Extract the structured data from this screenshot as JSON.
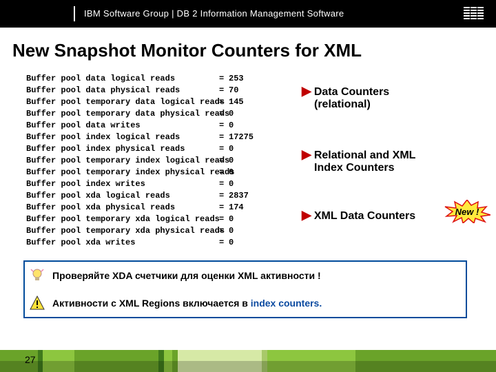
{
  "header": {
    "text": "IBM Software Group  |  DB 2 Information Management Software"
  },
  "title": "New Snapshot Monitor Counters for XML",
  "counters": [
    {
      "name": "Buffer pool data logical reads",
      "value": "253"
    },
    {
      "name": "Buffer pool data physical reads",
      "value": "70"
    },
    {
      "name": "Buffer pool temporary data logical reads",
      "value": "145"
    },
    {
      "name": "Buffer pool temporary data physical reads",
      "value": "0"
    },
    {
      "name": "Buffer pool data writes",
      "value": "0"
    },
    {
      "name": "Buffer pool index logical reads",
      "value": "17275"
    },
    {
      "name": "Buffer pool index physical reads",
      "value": "0"
    },
    {
      "name": "Buffer pool temporary index logical reads",
      "value": "0"
    },
    {
      "name": "Buffer pool temporary index physical reads",
      "value": "0"
    },
    {
      "name": "Buffer pool index writes",
      "value": "0"
    },
    {
      "name": "Buffer pool xda logical reads",
      "value": "2837"
    },
    {
      "name": "Buffer pool xda physical reads",
      "value": "174"
    },
    {
      "name": "Buffer pool temporary xda logical reads",
      "value": "0"
    },
    {
      "name": "Buffer pool temporary xda physical reads",
      "value": "0"
    },
    {
      "name": "Buffer pool xda writes",
      "value": "0"
    }
  ],
  "annotations": {
    "a1_l1": "Data Counters",
    "a1_l2": "(relational)",
    "a2_l1": "Relational and XML",
    "a2_l2": "Index Counters",
    "a3": "XML Data Counters",
    "new": "New !"
  },
  "notes": {
    "n1": "Проверяйте XDA счетчики для оценки XML активности !",
    "n2_a": "Активности с XML Regions включается в ",
    "n2_b": "index counters."
  },
  "footer": {
    "page": "27"
  }
}
